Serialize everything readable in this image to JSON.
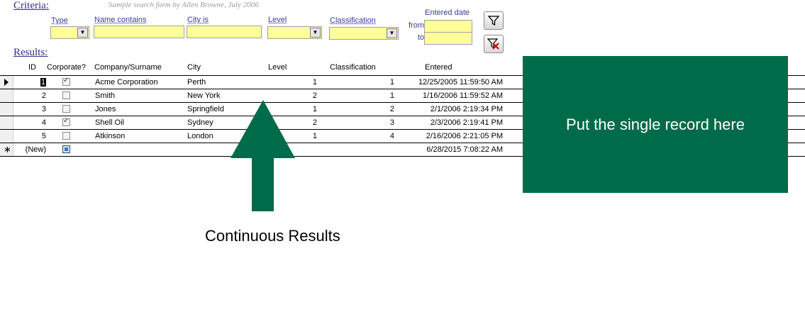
{
  "criteria": {
    "section_label": "Criteria:",
    "note": "Sample search form by Allen Browne, July 2006",
    "labels": {
      "type": "Type",
      "name_contains": "Name contains",
      "city_is": "City is",
      "level": "Level",
      "classification": "Classification",
      "entered_date": "Entered date",
      "from": "from",
      "to": "to"
    },
    "values": {
      "type": "",
      "name_contains": "",
      "city_is": "",
      "level": "",
      "classification": "",
      "from": "",
      "to": ""
    },
    "field_color": "#ffff99"
  },
  "results": {
    "section_label": "Results:",
    "columns": [
      "ID",
      "Corporate?",
      "Company/Surname",
      "City",
      "Level",
      "Classification",
      "Entered"
    ],
    "rows": [
      {
        "id": "1",
        "corporate": true,
        "name": "Acme Corporation",
        "city": "Perth",
        "level": "1",
        "classification": "1",
        "entered": "12/25/2005 11:59:50 AM"
      },
      {
        "id": "2",
        "corporate": false,
        "name": "Smith",
        "city": "New York",
        "level": "2",
        "classification": "1",
        "entered": "1/16/2006 11:59:52 AM"
      },
      {
        "id": "3",
        "corporate": false,
        "name": "Jones",
        "city": "Springfield",
        "level": "1",
        "classification": "2",
        "entered": "2/1/2006 2:19:34 PM"
      },
      {
        "id": "4",
        "corporate": true,
        "name": "Shell Oil",
        "city": "Sydney",
        "level": "2",
        "classification": "3",
        "entered": "2/3/2006 2:19:41 PM"
      },
      {
        "id": "5",
        "corporate": false,
        "name": "Atkinson",
        "city": "London",
        "level": "1",
        "classification": "4",
        "entered": "2/16/2006 2:21:05 PM"
      }
    ],
    "new_row": {
      "id": "(New)",
      "entered": "6/28/2015 7:08:22 AM"
    }
  },
  "annotations": {
    "single_record_text": "Put the single record here",
    "continuous_results_text": "Continuous Results",
    "green_color": "#006b48"
  },
  "icons": {
    "filter": "filter-icon",
    "remove_filter": "remove-filter-icon"
  }
}
